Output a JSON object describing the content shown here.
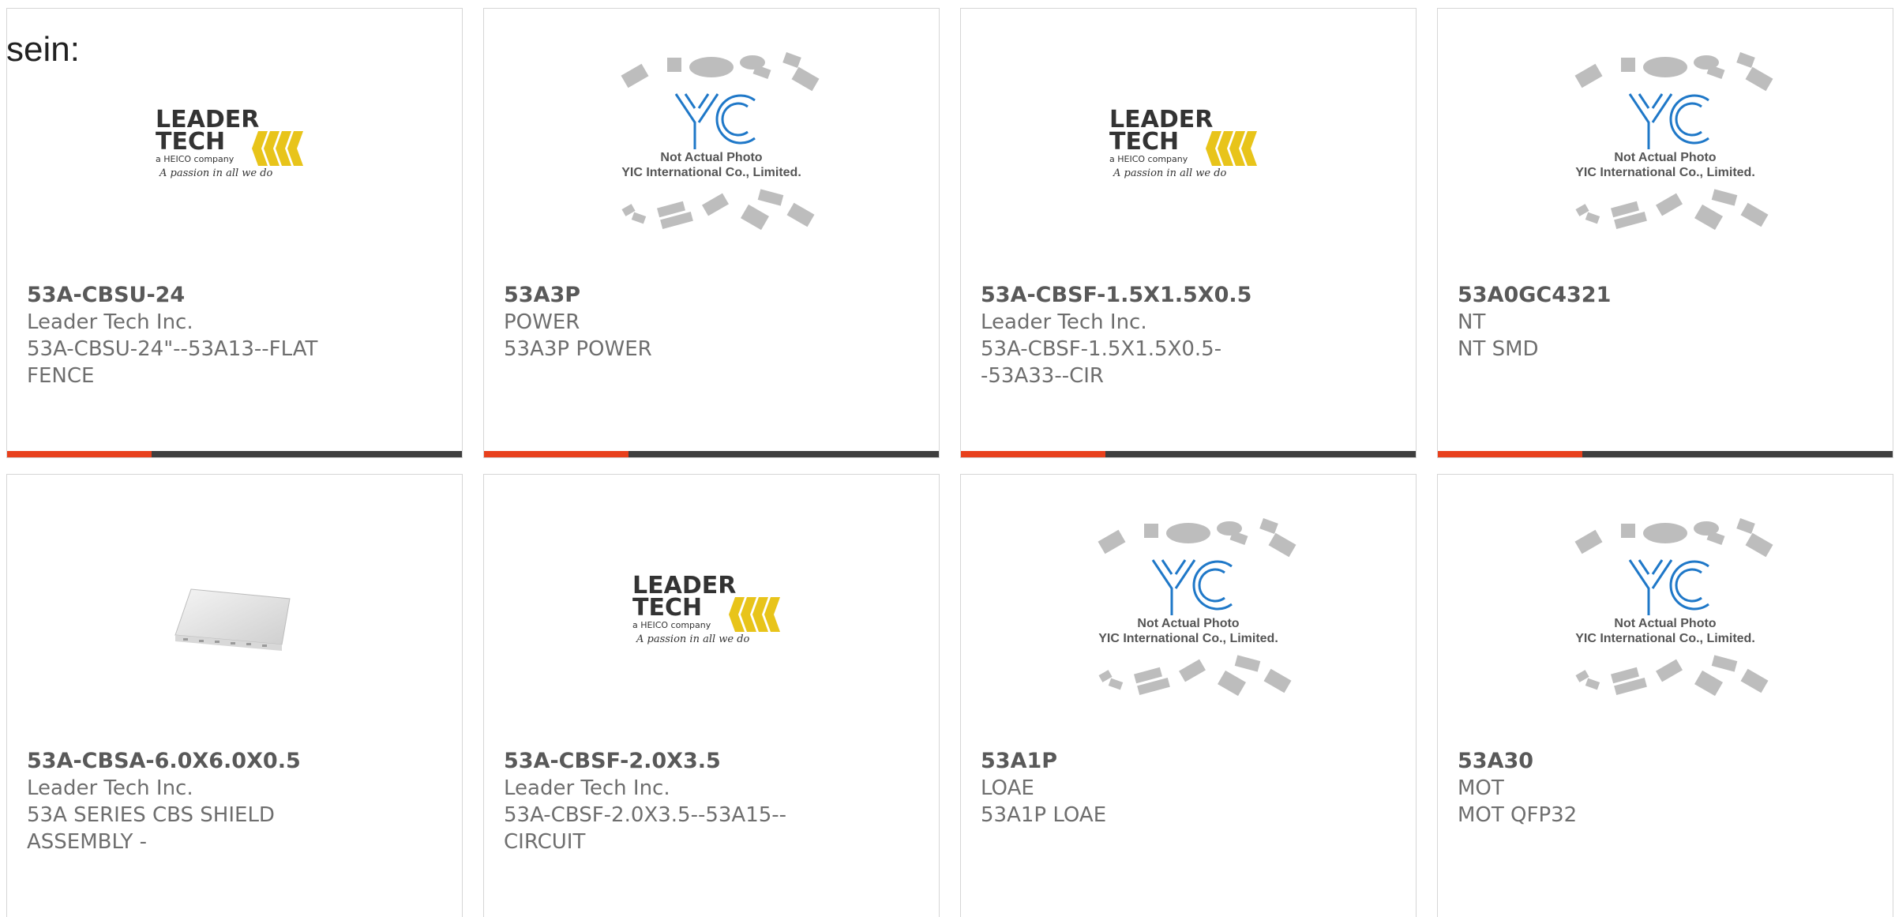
{
  "lead_text": "sein:",
  "cards": [
    {
      "part": "53A-CBSU-24",
      "mfr": "Leader Tech Inc.",
      "desc": "53A-CBSU-24\"--53A13--FLAT FENCE",
      "image": "leader-tech-logo"
    },
    {
      "part": "53A3P",
      "mfr": "POWER",
      "desc": "53A3P POWER",
      "image": "yic-placeholder"
    },
    {
      "part": "53A-CBSF-1.5X1.5X0.5",
      "mfr": "Leader Tech Inc.",
      "desc": "53A-CBSF-1.5X1.5X0.5--53A33--CIR",
      "image": "leader-tech-logo"
    },
    {
      "part": "53A0GC4321",
      "mfr": "NT",
      "desc": "NT SMD",
      "image": "yic-placeholder"
    },
    {
      "part": "53A-CBSA-6.0X6.0X0.5",
      "mfr": "Leader Tech Inc.",
      "desc": "53A SERIES CBS SHIELD ASSEMBLY -",
      "image": "shield-product-photo"
    },
    {
      "part": "53A-CBSF-2.0X3.5",
      "mfr": "Leader Tech Inc.",
      "desc": "53A-CBSF-2.0X3.5--53A15--CIRCUIT",
      "image": "leader-tech-logo"
    },
    {
      "part": "53A1P",
      "mfr": "LOAE",
      "desc": "53A1P LOAE",
      "image": "yic-placeholder"
    },
    {
      "part": "53A30",
      "mfr": "MOT",
      "desc": "MOT QFP32",
      "image": "yic-placeholder"
    }
  ],
  "logo": {
    "line1": "LEADER",
    "line2": "TECH",
    "line3": "a HEICO company",
    "line4": "A passion in all we do"
  },
  "placeholder": {
    "brand": "YIC",
    "line1": "Not Actual Photo",
    "line2": "YIC International Co., Limited."
  },
  "colors": {
    "accent_bar": "#e8401c",
    "bar": "#3e3e3e",
    "logo_yellow": "#e8c41a",
    "yic_blue": "#1f78c8"
  }
}
